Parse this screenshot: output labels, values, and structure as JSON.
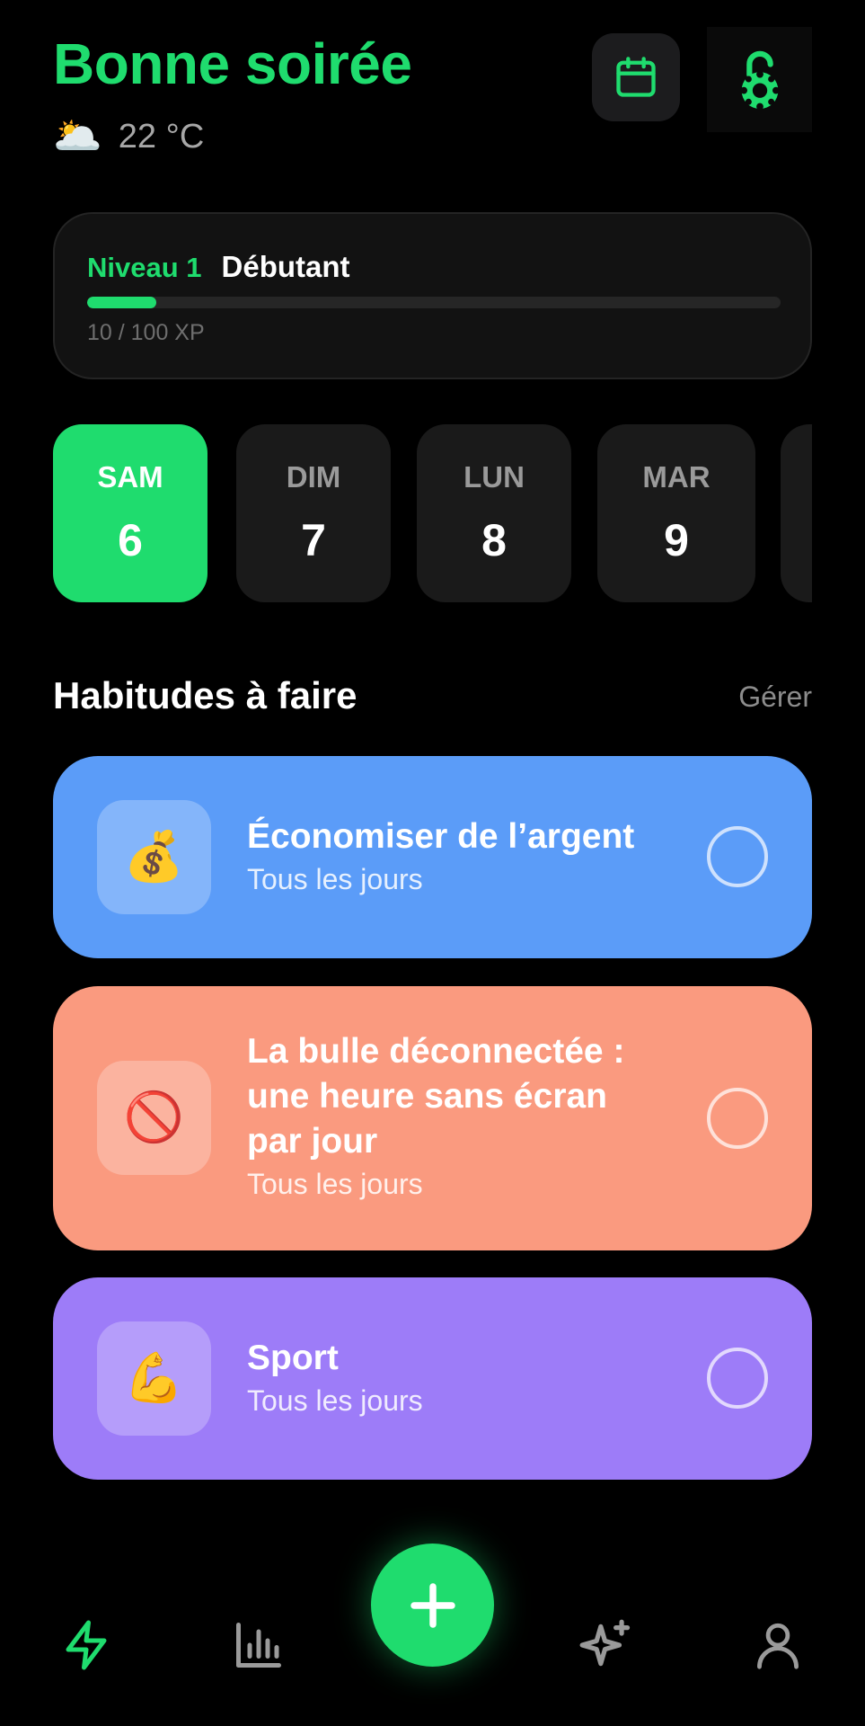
{
  "header": {
    "greeting": "Bonne soirée",
    "weather_emoji": "🌥️",
    "temperature": "22 °C",
    "calendar_icon": "calendar-icon",
    "lock_icon": "lock-settings-icon"
  },
  "level": {
    "level_label": "Niveau 1",
    "title": "Débutant",
    "xp_text": "10 / 100 XP",
    "progress": 0.1
  },
  "days": [
    {
      "name": "SAM",
      "num": "6",
      "active": true
    },
    {
      "name": "DIM",
      "num": "7",
      "active": false
    },
    {
      "name": "LUN",
      "num": "8",
      "active": false
    },
    {
      "name": "MAR",
      "num": "9",
      "active": false
    }
  ],
  "habits_section": {
    "title": "Habitudes à faire",
    "manage": "Gérer"
  },
  "habits": [
    {
      "emoji": "💰",
      "title": "Économiser de l’argent",
      "frequency": "Tous les jours",
      "color": "#5b9cf8",
      "checked": false
    },
    {
      "emoji": "🚫",
      "title": "La bulle déconnectée : une heure sans écran par jour",
      "frequency": "Tous les jours",
      "color": "#fa9a7f",
      "checked": false
    },
    {
      "emoji": "💪",
      "title": "Sport",
      "frequency": "Tous les jours",
      "color": "#9d7cf8",
      "checked": false
    }
  ],
  "tabbar": {
    "items": [
      "bolt-icon",
      "bar-chart-icon",
      "add-icon",
      "sparkles-icon",
      "profile-icon"
    ],
    "active": "bolt-icon"
  },
  "colors": {
    "accent": "#1fdc6e",
    "background": "#000000",
    "card": "#121212"
  }
}
